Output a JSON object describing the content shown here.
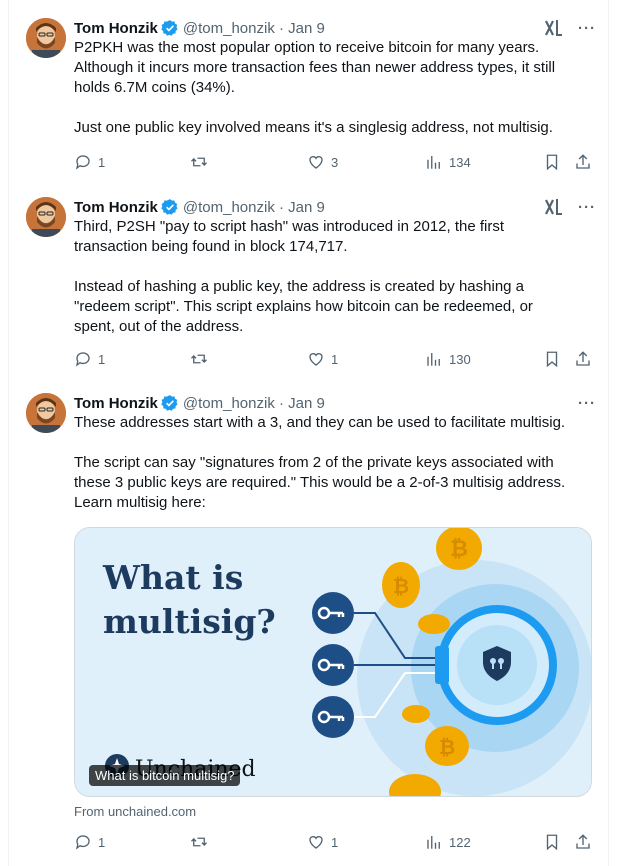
{
  "tweets": [
    {
      "author": "Tom Honzik",
      "handle": "@tom_honzik",
      "date": "Jan 9",
      "lines": [
        "P2PKH was the most popular option to receive bitcoin for many years.",
        "Although it incurs more transaction fees than newer address types, it still",
        "holds 6.7M coins (34%).",
        "",
        "Just one public key involved means it's a singlesig address, not multisig."
      ],
      "replies": "1",
      "reposts": "",
      "likes": "3",
      "views": "134"
    },
    {
      "author": "Tom Honzik",
      "handle": "@tom_honzik",
      "date": "Jan 9",
      "lines": [
        "Third, P2SH \"pay to script hash\" was introduced in 2012, the first",
        "transaction being found in block 174,717.",
        "",
        "Instead of hashing a public key, the address is created by hashing a",
        "\"redeem script\". This script explains how bitcoin can be redeemed, or",
        "spent, out of the address."
      ],
      "replies": "1",
      "reposts": "",
      "likes": "1",
      "views": "130"
    },
    {
      "author": "Tom Honzik",
      "handle": "@tom_honzik",
      "date": "Jan 9",
      "lines": [
        "These addresses start with a 3, and they can be used to facilitate multisig.",
        "",
        "The script can say \"signatures from 2 of the private keys associated with",
        "these 3 public keys are required.\" This would be a 2-of-3 multisig address.",
        "Learn multisig here:"
      ],
      "card": {
        "headline_1": "What is",
        "headline_2": "multisig?",
        "brand": "Unchained",
        "caption": "What is bitcoin multisig?",
        "source": "From unchained.com"
      },
      "replies": "1",
      "reposts": "",
      "likes": "1",
      "views": "122"
    }
  ],
  "icons": {
    "verified": "verified-badge-icon",
    "grok": "grok-icon",
    "more": "more-icon",
    "reply": "reply-icon",
    "repost": "repost-icon",
    "like": "like-icon",
    "views": "views-icon",
    "bookmark": "bookmark-icon",
    "share": "share-icon"
  },
  "colors": {
    "text": "#0f1419",
    "muted": "#536471",
    "verified": "#1d9bf0",
    "card_bg": "#dff0fb",
    "card_navy": "#1d3a5f",
    "coin": "#f2a900"
  }
}
